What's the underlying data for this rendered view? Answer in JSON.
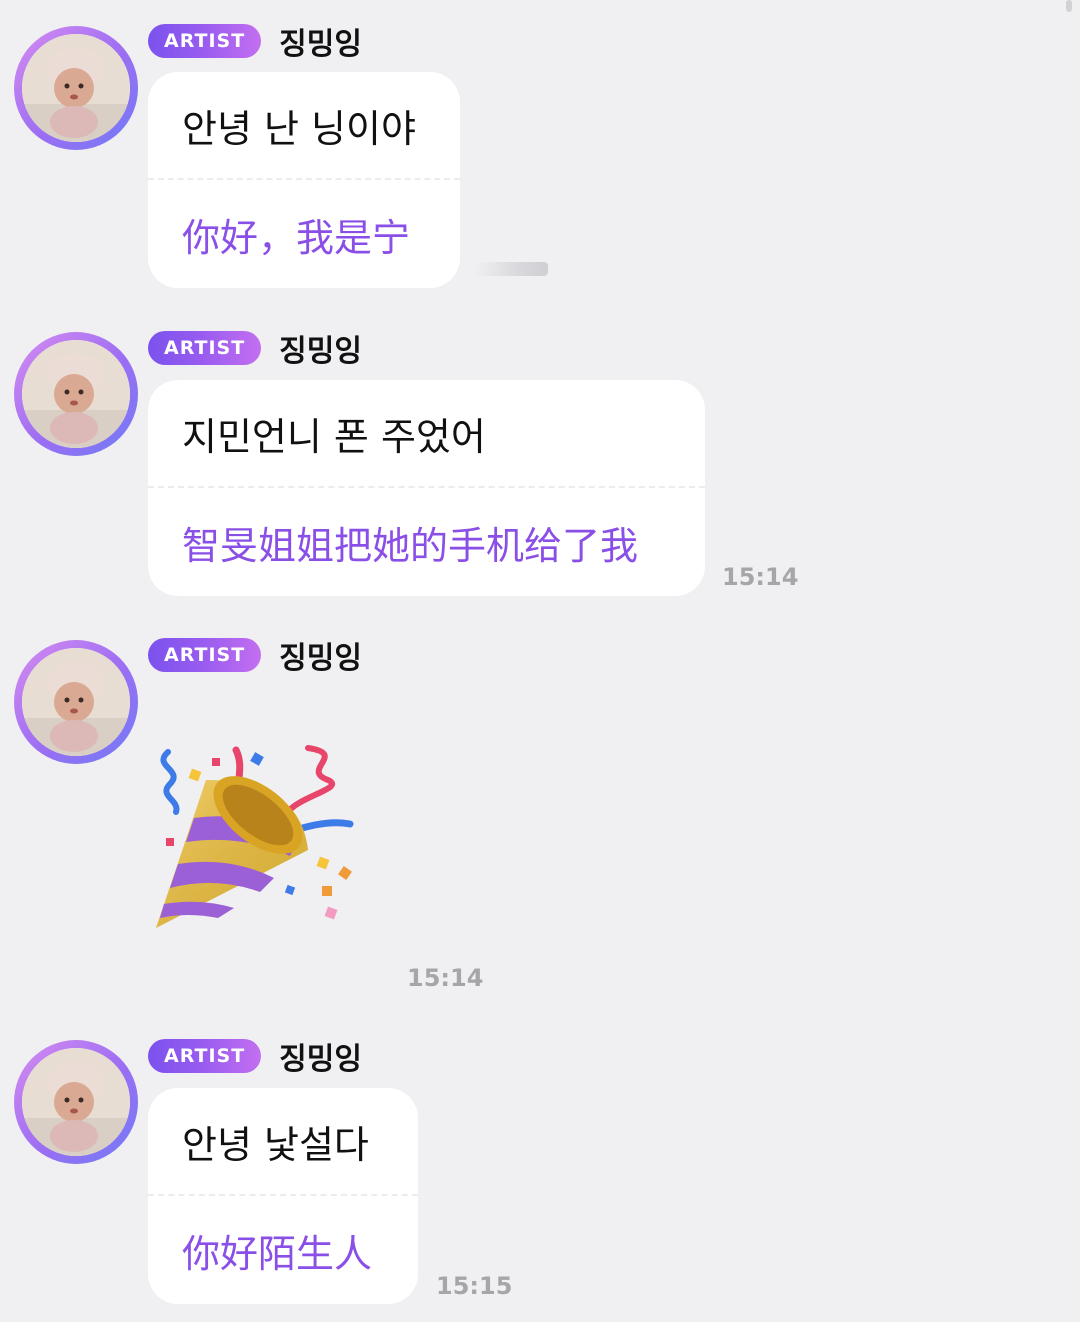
{
  "messages": [
    {
      "badge": "ARTIST",
      "sender": "징밍잉",
      "original": "안녕 난 닝이야",
      "translation": "你好，我是宁",
      "time": ""
    },
    {
      "badge": "ARTIST",
      "sender": "징밍잉",
      "original": "지민언니 폰 주었어",
      "translation": "智旻姐姐把她的手机给了我",
      "time": "15:14"
    },
    {
      "badge": "ARTIST",
      "sender": "징밍잉",
      "emoji": "party-popper",
      "time": "15:14"
    },
    {
      "badge": "ARTIST",
      "sender": "징밍잉",
      "original": "안녕 낯설다",
      "translation": "你好陌生人",
      "time": "15:15"
    }
  ],
  "colors": {
    "background": "#f0f0f2",
    "translation_text": "#8a4fe6",
    "badge_start": "#7b52ee",
    "badge_end": "#c36ff0",
    "timestamp": "#a6a6aa"
  }
}
